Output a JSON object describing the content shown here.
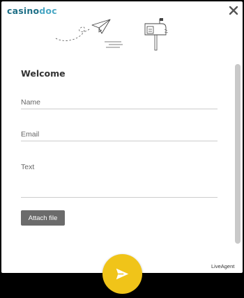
{
  "brand": {
    "logo_text_main": "casino",
    "logo_text_accent": "doc",
    "logo_color": "#1e6f86",
    "logo_accent_color": "#4aa7c4"
  },
  "form": {
    "title": "Welcome",
    "name_placeholder": "Name",
    "email_placeholder": "Email",
    "text_placeholder": "Text",
    "attach_label": "Attach file"
  },
  "footer": {
    "powered_by": "LiveAgent"
  },
  "icons": {
    "close": "close-icon",
    "send": "send-icon",
    "illustration": "paper-plane-mailbox-illustration"
  },
  "colors": {
    "send_button": "#f0c419",
    "attach_button": "#6b6b6b",
    "backdrop": "#000000"
  }
}
